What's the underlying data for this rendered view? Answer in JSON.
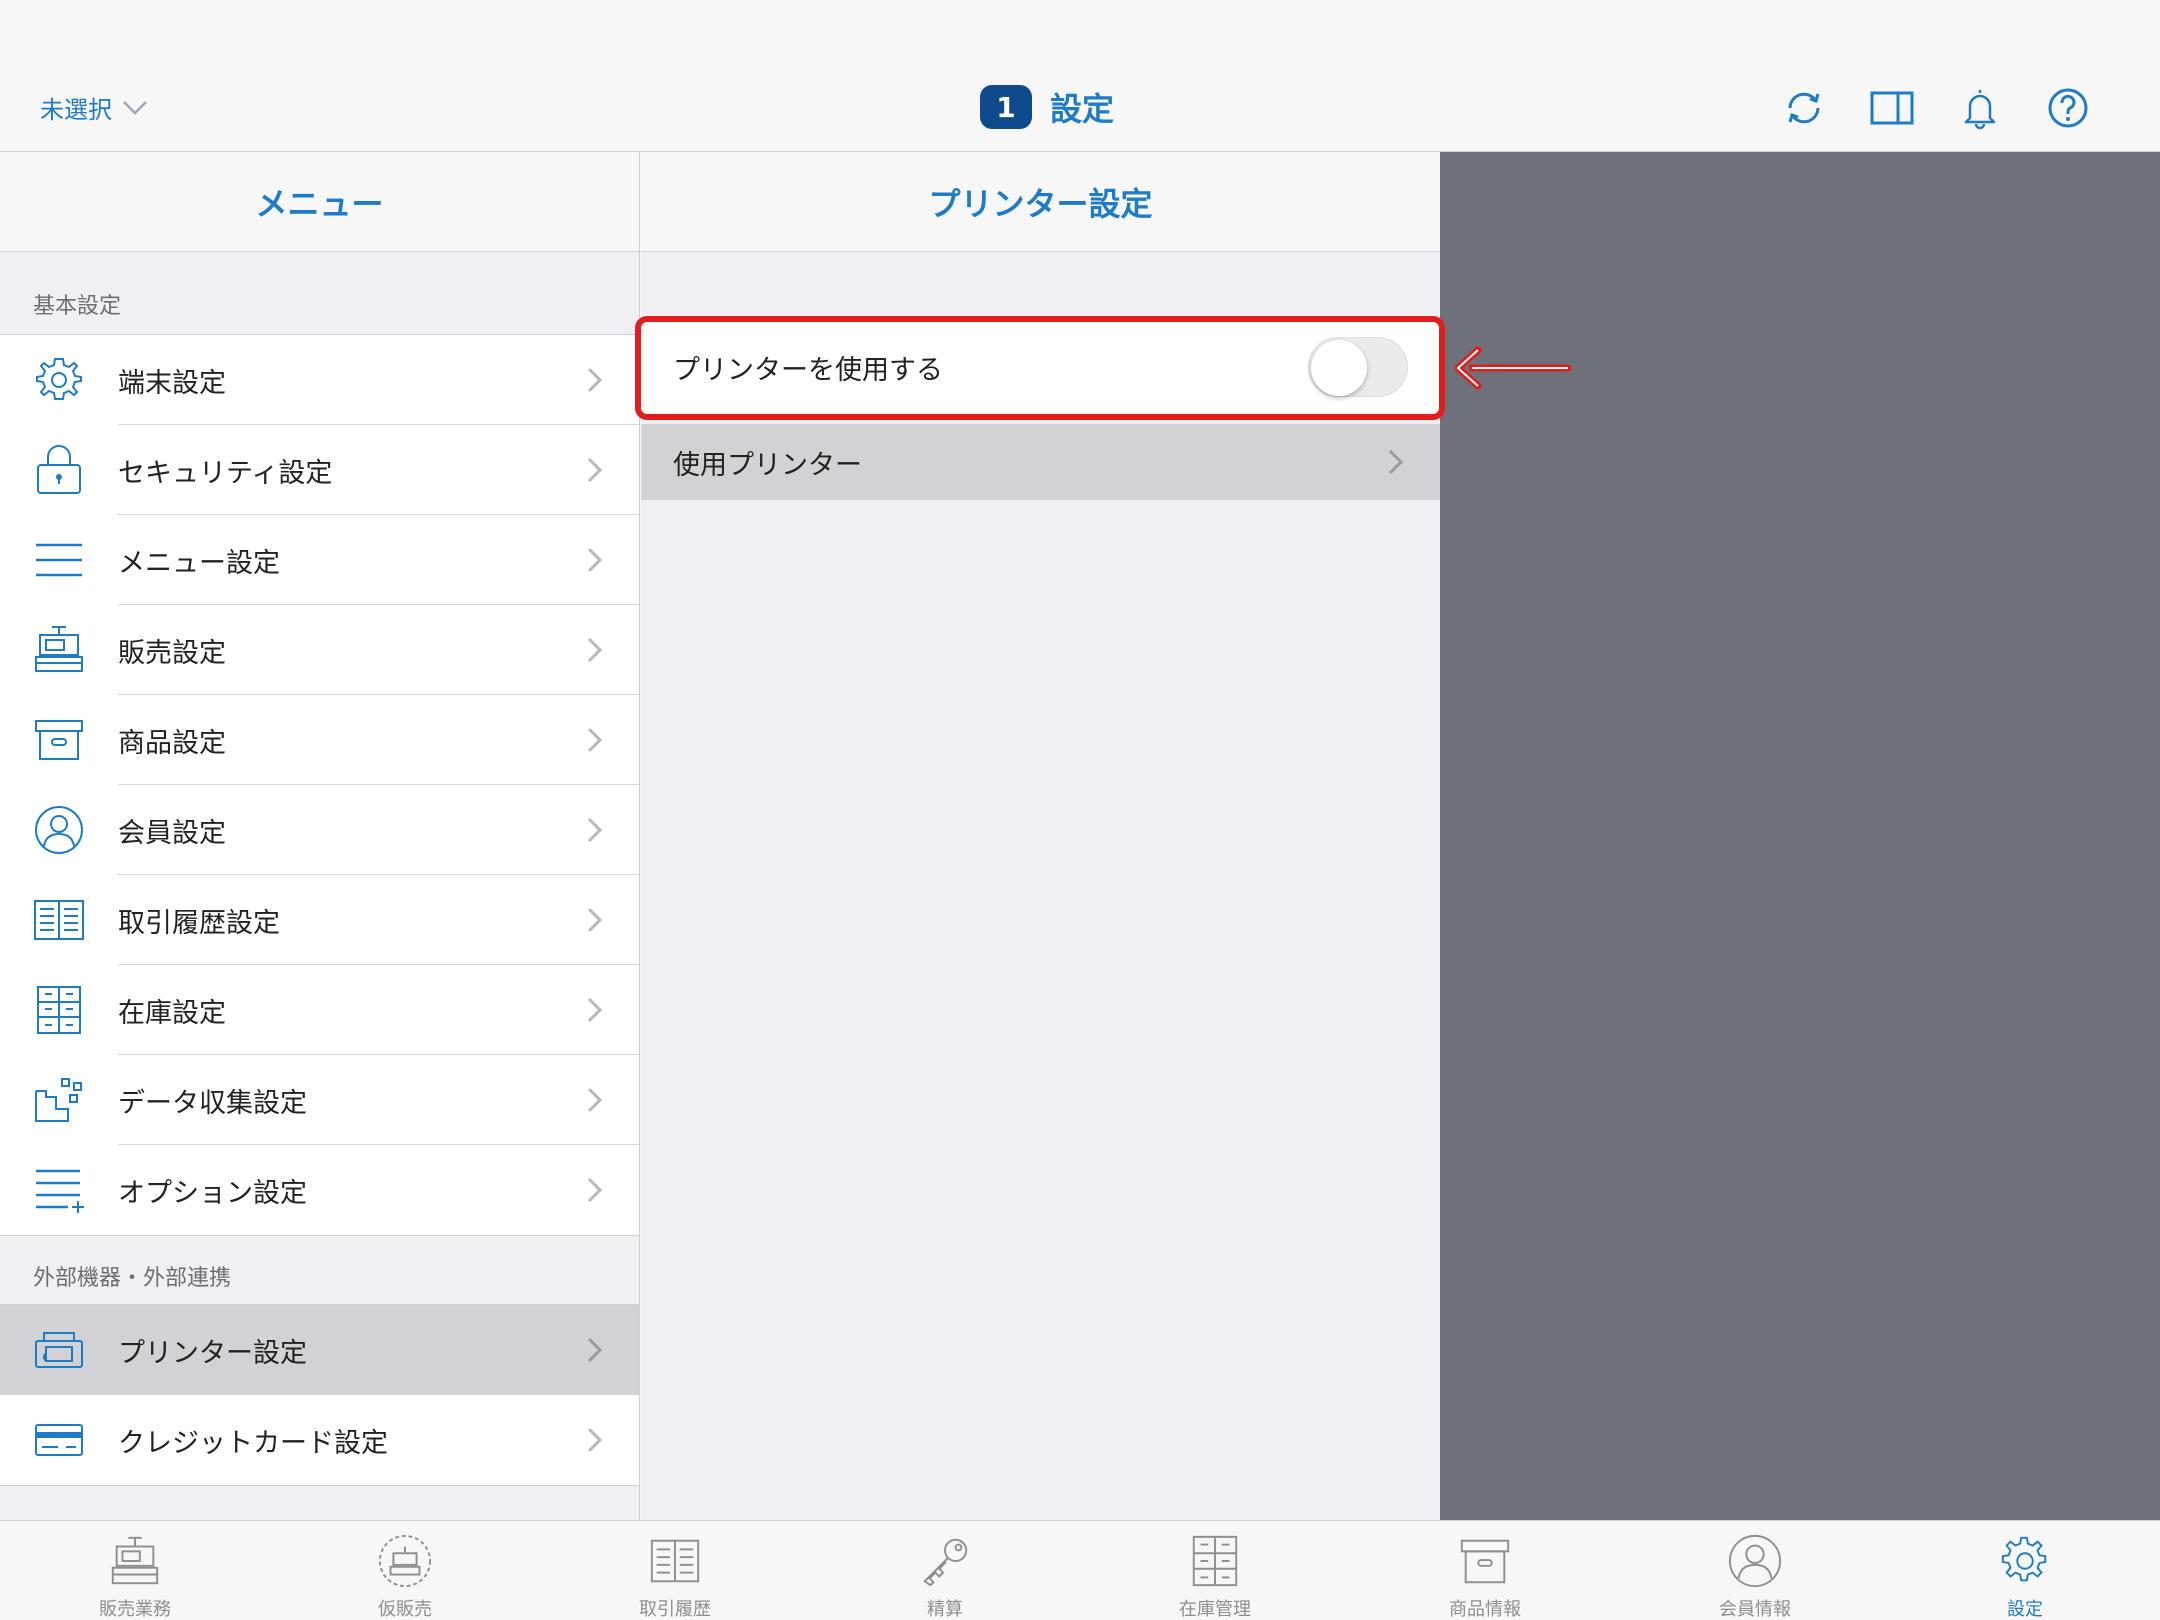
{
  "header": {
    "store_select": "未選択",
    "badge": "1",
    "title": "設定",
    "icons": [
      "sync-icon",
      "split-view-icon",
      "bell-icon",
      "help-icon"
    ]
  },
  "menu": {
    "title": "メニュー",
    "sections": [
      {
        "label": "基本設定",
        "items": [
          {
            "label": "端末設定",
            "icon": "gear-icon"
          },
          {
            "label": "セキュリティ設定",
            "icon": "lock-icon"
          },
          {
            "label": "メニュー設定",
            "icon": "menu-lines-icon"
          },
          {
            "label": "販売設定",
            "icon": "register-icon"
          },
          {
            "label": "商品設定",
            "icon": "box-icon"
          },
          {
            "label": "会員設定",
            "icon": "member-icon"
          },
          {
            "label": "取引履歴設定",
            "icon": "book-icon"
          },
          {
            "label": "在庫設定",
            "icon": "cabinet-icon"
          },
          {
            "label": "データ収集設定",
            "icon": "data-icon"
          },
          {
            "label": "オプション設定",
            "icon": "option-list-icon"
          }
        ]
      },
      {
        "label": "外部機器・外部連携",
        "items": [
          {
            "label": "プリンター設定",
            "icon": "printer-icon",
            "selected": true
          },
          {
            "label": "クレジットカード設定",
            "icon": "credit-card-icon"
          }
        ]
      }
    ]
  },
  "detail": {
    "title": "プリンター設定",
    "toggle_label": "プリンターを使用する",
    "toggle_on": false,
    "printer_label": "使用プリンター"
  },
  "tabs": [
    {
      "label": "販売業務",
      "icon": "register-icon"
    },
    {
      "label": "仮販売",
      "icon": "temp-sale-icon"
    },
    {
      "label": "取引履歴",
      "icon": "book-icon"
    },
    {
      "label": "精算",
      "icon": "key-icon"
    },
    {
      "label": "在庫管理",
      "icon": "cabinet-icon"
    },
    {
      "label": "商品情報",
      "icon": "box-icon"
    },
    {
      "label": "会員情報",
      "icon": "member-icon"
    },
    {
      "label": "設定",
      "icon": "gear-icon",
      "active": true
    }
  ],
  "colors": {
    "accent": "#1e7bc6",
    "badge": "#0e4a8c",
    "highlight": "#e31c1c",
    "selected_row": "#d1d1d6",
    "empty_pane": "#6e7179"
  }
}
